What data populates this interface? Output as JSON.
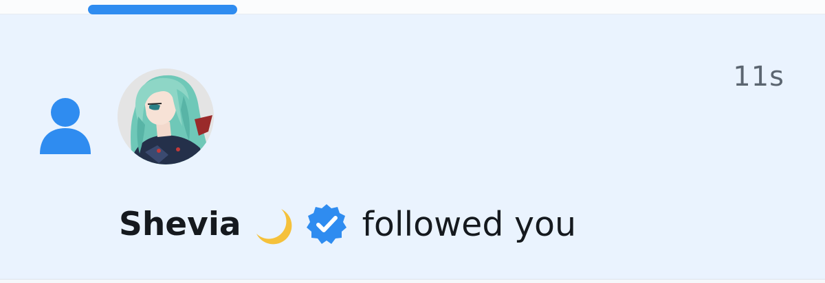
{
  "notification": {
    "actor_name": "Shevia",
    "actor_name_emoji": "🌙",
    "action_text": "followed you",
    "timestamp": "11s",
    "verified": true,
    "type_icon": "person-icon",
    "badge_icon": "verified-badge-icon"
  },
  "colors": {
    "accent": "#2f8cf0",
    "card_background": "#eaf3fe",
    "text_primary": "#15191e",
    "text_secondary": "#5b6570"
  }
}
